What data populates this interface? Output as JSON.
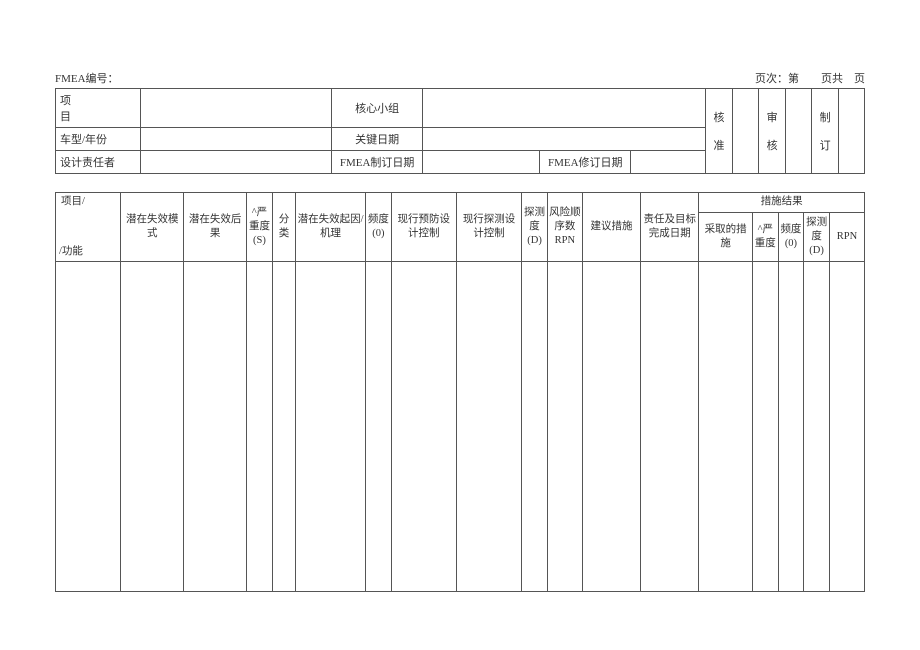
{
  "top": {
    "fmea_no_label": "FMEA编号：",
    "page_label": "页次：第　　页共　页"
  },
  "info": {
    "r1c1": "项　　目",
    "r1c2": "核心小组",
    "r2c1": "车型/年份",
    "r2c2": "关键日期",
    "r3c1": "设计责任者",
    "r3c2": "FMEA制订日期",
    "r3c3": "FMEA修订日期",
    "approve1": "核",
    "approve2": "准",
    "review1": "审",
    "review2": "核",
    "make1": "制",
    "make2": "订"
  },
  "head": {
    "c1a": "项目/",
    "c1b": "/功能",
    "c2": "潜在失效模式",
    "c3": "潜在失效后果",
    "c4": "^严重度(S)",
    "c5": "分类",
    "c6": "潜在失效起因/机理",
    "c7": "频度(0)",
    "c8": "现行预防设计控制",
    "c9": "现行探测设计控制",
    "c10": "探测度(D)",
    "c11": "风险顺序数RPN",
    "c12": "建议措施",
    "c13": "责任及目标完成日期",
    "res_group": "措施结果",
    "r1": "采取的措施",
    "r2": "^严重度",
    "r3": "频度(0)",
    "r4": "探测度(D)",
    "r5": "RPN"
  }
}
